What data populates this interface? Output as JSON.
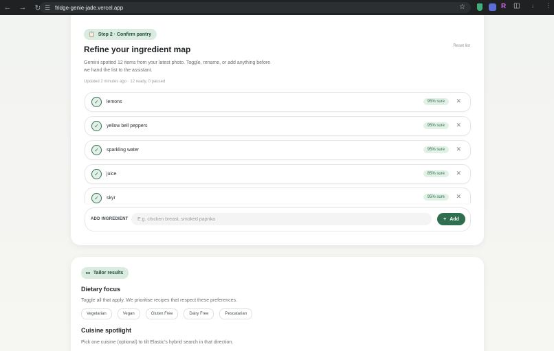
{
  "browser": {
    "url": "fridge-genie-jade.vercel.app",
    "back_icon": "arrow-left-icon",
    "forward_icon": "arrow-right-icon",
    "reload_icon": "reload-icon"
  },
  "pantry": {
    "step_label": "Step 2 · Confirm pantry",
    "title": "Refine your ingredient map",
    "description_line1": "Gemini spotted 12 items from your latest photo. Toggle, rename, or add anything before",
    "description_line2": "we hand the list to the assistant.",
    "meta": "Updated 2 minutes ago · 12 ready, 0 paused",
    "reset_label": "Reset list",
    "items": [
      {
        "name": "lemons",
        "confidence": "95% sure"
      },
      {
        "name": "yellow bell peppers",
        "confidence": "95% sure"
      },
      {
        "name": "sparkling water",
        "confidence": "95% sure"
      },
      {
        "name": "juice",
        "confidence": "85% sure"
      },
      {
        "name": "skyr",
        "confidence": "95% sure"
      }
    ],
    "add": {
      "label": "ADD INGREDIENT",
      "placeholder": "E.g. chicken breast, smoked paprika",
      "value": "",
      "button": "Add"
    }
  },
  "tailor": {
    "badge": "Tailor results",
    "dietary_title": "Dietary focus",
    "dietary_desc": "Toggle all that apply. We prioritise recipes that respect these preferences.",
    "dietary_options": [
      "Vegetarian",
      "Vegan",
      "Gluten Free",
      "Dairy Free",
      "Pescatarian"
    ],
    "cuisine_title": "Cuisine spotlight",
    "cuisine_desc": "Pick one cuisine (optional) to tilt Elastic’s hybrid search in that direction."
  },
  "colors": {
    "accent": "#2f6e4e",
    "accent_soft": "#d9ecdf"
  }
}
